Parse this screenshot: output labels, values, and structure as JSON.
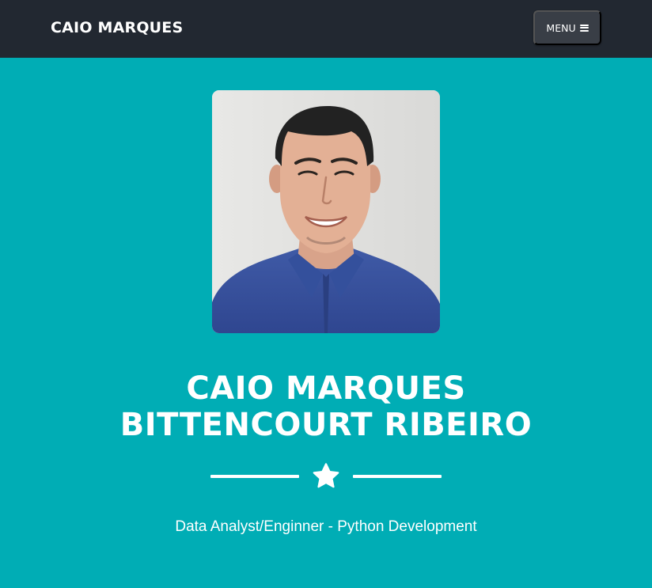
{
  "navbar": {
    "brand": "CAIO MARQUES",
    "menu_label": "MENU",
    "menu_icon": "hamburger-icon"
  },
  "masthead": {
    "avatar_alt": "Profile photo",
    "heading_line1": "CAIO MARQUES",
    "heading_line2": "BITTENCOURT RIBEIRO",
    "divider_icon": "star-icon",
    "subheading": "Data Analyst/Enginner - Python Development"
  },
  "colors": {
    "navbar_bg": "#222831",
    "menu_button_bg": "#393e46",
    "page_bg": "#00adb5",
    "text": "#ffffff"
  }
}
